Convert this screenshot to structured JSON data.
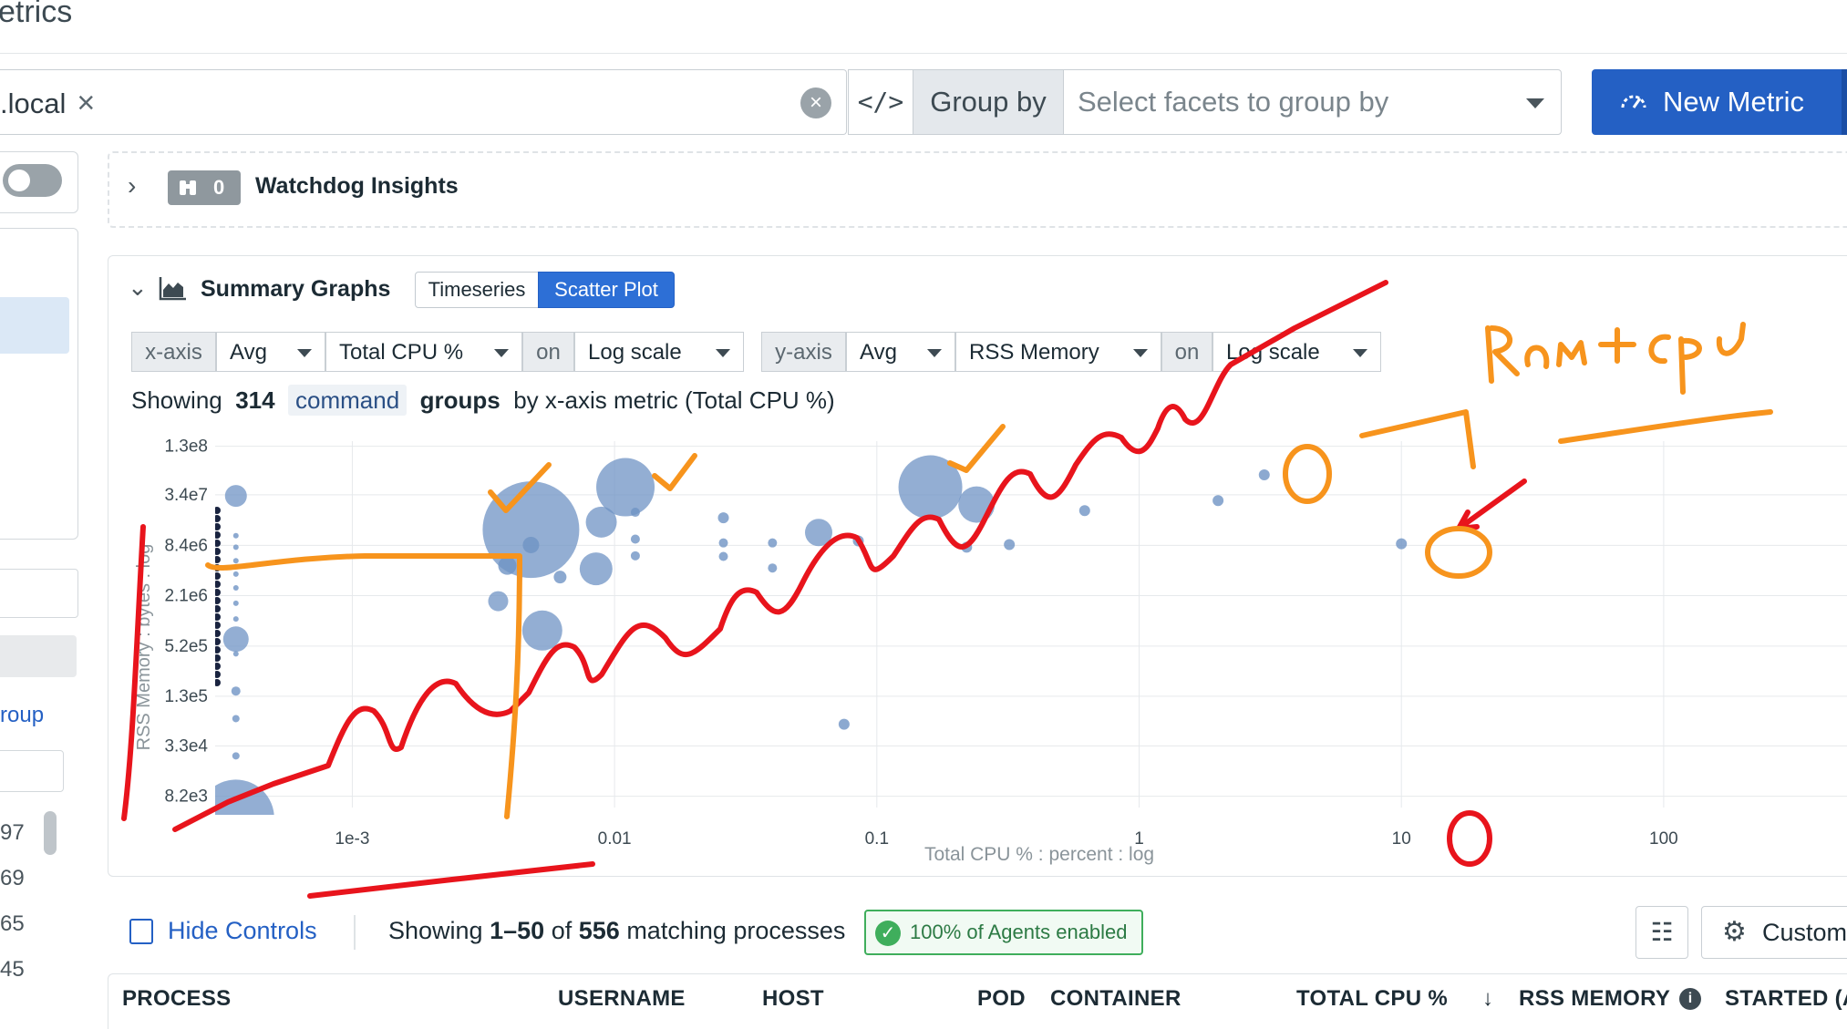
{
  "page": {
    "title": "etrics"
  },
  "search": {
    "chip_label": ".local",
    "chip_close": "×",
    "clear_icon": "×",
    "code_icon": "</>"
  },
  "group_by": {
    "label": "Group by",
    "placeholder": "Select facets to group by"
  },
  "new_metric": {
    "label": "New Metric",
    "icon": "speedometer-icon"
  },
  "sidebar": {
    "link_text": "roup",
    "counts": [
      "97",
      "69",
      "65",
      "45"
    ]
  },
  "watchdog": {
    "count": "0",
    "title": "Watchdog Insights",
    "icon": "binoculars-icon"
  },
  "summary": {
    "title": "Summary Graphs",
    "tabs": [
      {
        "label": "Timeseries",
        "active": false
      },
      {
        "label": "Scatter Plot",
        "active": true
      }
    ],
    "x_controls": {
      "axis": "x-axis",
      "agg": "Avg",
      "metric": "Total CPU %",
      "on": "on",
      "scale": "Log scale"
    },
    "y_controls": {
      "axis": "y-axis",
      "agg": "Avg",
      "metric": "RSS Memory",
      "on": "on",
      "scale": "Log scale"
    },
    "showing": {
      "prefix": "Showing",
      "count": "314",
      "facet": "command",
      "groups": "groups",
      "suffix": "by x-axis metric (Total CPU %)"
    }
  },
  "chart_data": {
    "type": "scatter",
    "xlabel": "Total CPU % : percent : log",
    "ylabel": "RSS Memory : bytes : log",
    "x_scale": "log",
    "y_scale": "log",
    "xlim": [
      0.0003,
      500
    ],
    "ylim": [
      6000,
      150000000
    ],
    "x_ticks": [
      {
        "value": 0.001,
        "label": "1e-3"
      },
      {
        "value": 0.01,
        "label": "0.01"
      },
      {
        "value": 0.1,
        "label": "0.1"
      },
      {
        "value": 1,
        "label": "1"
      },
      {
        "value": 10,
        "label": "10"
      },
      {
        "value": 100,
        "label": "100"
      }
    ],
    "y_ticks": [
      {
        "value": 8200,
        "label": "8.2e3"
      },
      {
        "value": 33000,
        "label": "3.3e4"
      },
      {
        "value": 130000,
        "label": "1.3e5"
      },
      {
        "value": 520000,
        "label": "5.2e5"
      },
      {
        "value": 2100000,
        "label": "2.1e6"
      },
      {
        "value": 8400000,
        "label": "8.4e6"
      },
      {
        "value": 34000000,
        "label": "3.4e7"
      },
      {
        "value": 130000000,
        "label": "1.3e8"
      }
    ],
    "grid": true,
    "bubble_color": "#6f93c4",
    "points": [
      {
        "x": 0.00036,
        "y": 33000000,
        "r": 12
      },
      {
        "x": 0.00036,
        "y": 630000,
        "r": 14
      },
      {
        "x": 0.00036,
        "y": 4500,
        "r": 42
      },
      {
        "x": 0.00036,
        "y": 11000000,
        "r": 3
      },
      {
        "x": 0.00036,
        "y": 8000000,
        "r": 3
      },
      {
        "x": 0.00036,
        "y": 5500000,
        "r": 3
      },
      {
        "x": 0.00036,
        "y": 3800000,
        "r": 3
      },
      {
        "x": 0.00036,
        "y": 2600000,
        "r": 3
      },
      {
        "x": 0.00036,
        "y": 1700000,
        "r": 3
      },
      {
        "x": 0.00036,
        "y": 1100000,
        "r": 3
      },
      {
        "x": 0.00036,
        "y": 420000,
        "r": 3
      },
      {
        "x": 0.00036,
        "y": 150000,
        "r": 5
      },
      {
        "x": 0.00036,
        "y": 70000,
        "r": 4
      },
      {
        "x": 0.00036,
        "y": 25000,
        "r": 4
      },
      {
        "x": 0.0048,
        "y": 13000000,
        "r": 53
      },
      {
        "x": 0.0048,
        "y": 8500000,
        "r": 9
      },
      {
        "x": 0.011,
        "y": 42000000,
        "r": 32
      },
      {
        "x": 0.0089,
        "y": 16000000,
        "r": 17
      },
      {
        "x": 0.0085,
        "y": 4400000,
        "r": 18
      },
      {
        "x": 0.0039,
        "y": 4800000,
        "r": 10
      },
      {
        "x": 0.0062,
        "y": 3500000,
        "r": 7
      },
      {
        "x": 0.0036,
        "y": 1800000,
        "r": 11
      },
      {
        "x": 0.0053,
        "y": 800000,
        "r": 22
      },
      {
        "x": 0.012,
        "y": 21000000,
        "r": 5
      },
      {
        "x": 0.012,
        "y": 10000000,
        "r": 5
      },
      {
        "x": 0.012,
        "y": 6300000,
        "r": 5
      },
      {
        "x": 0.026,
        "y": 18000000,
        "r": 6
      },
      {
        "x": 0.026,
        "y": 9000000,
        "r": 5
      },
      {
        "x": 0.026,
        "y": 6200000,
        "r": 5
      },
      {
        "x": 0.04,
        "y": 9000000,
        "r": 5
      },
      {
        "x": 0.04,
        "y": 4500000,
        "r": 5
      },
      {
        "x": 0.06,
        "y": 12000000,
        "r": 15
      },
      {
        "x": 0.085,
        "y": 9500000,
        "r": 6
      },
      {
        "x": 0.075,
        "y": 60000,
        "r": 6
      },
      {
        "x": 0.16,
        "y": 42000000,
        "r": 35
      },
      {
        "x": 0.24,
        "y": 26000000,
        "r": 20
      },
      {
        "x": 0.22,
        "y": 8000000,
        "r": 6
      },
      {
        "x": 0.32,
        "y": 8600000,
        "r": 6
      },
      {
        "x": 0.62,
        "y": 22000000,
        "r": 6
      },
      {
        "x": 2.0,
        "y": 29000000,
        "r": 6
      },
      {
        "x": 3.0,
        "y": 59000000,
        "r": 6
      },
      {
        "x": 10,
        "y": 8800000,
        "r": 6
      }
    ]
  },
  "bottom_bar": {
    "hide_controls": "Hide Controls",
    "showing_pre": "Showing",
    "range": "1–50",
    "of": "of",
    "total": "556",
    "suffix": "matching processes",
    "agents_badge": "100% of Agents enabled",
    "settings_icon": "sliders-icon",
    "custom_label": "Custom"
  },
  "table": {
    "columns": [
      "PROCESS",
      "USERNAME",
      "HOST",
      "POD",
      "CONTAINER",
      "TOTAL CPU %",
      "RSS MEMORY",
      "STARTED (A"
    ]
  },
  "annotations": {
    "handwritten_text": "RAM+CPU",
    "colors": {
      "red": "#e8141c",
      "orange": "#f7941d"
    }
  }
}
